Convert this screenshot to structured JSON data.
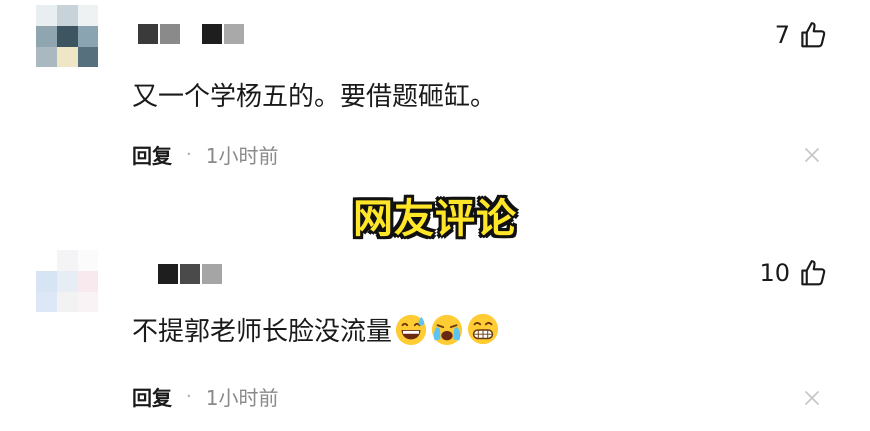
{
  "comments": [
    {
      "text": "又一个学杨五的。要借题砸缸。",
      "likes": "7",
      "reply_label": "回复",
      "separator": "·",
      "time": "1小时前",
      "emojis": []
    },
    {
      "text": "不提郭老师长脸没流量",
      "likes": "10",
      "reply_label": "回复",
      "separator": "·",
      "time": "1小时前",
      "emojis": [
        "grinning-sweat-emoji",
        "loudly-crying-emoji",
        "beaming-grin-emoji"
      ]
    }
  ],
  "banner": {
    "text": "网友评论",
    "color": "#ffe629"
  },
  "colors": {
    "text": "#1a1a1a",
    "time": "#8a8a8a",
    "close": "#c8c8c8"
  }
}
